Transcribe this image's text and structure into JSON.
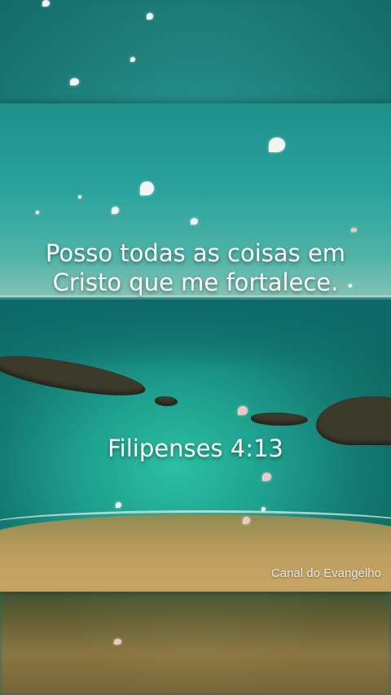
{
  "verse": {
    "text": "Posso todas as coisas em Cristo que me fortalece.",
    "reference": "Filipenses 4:13"
  },
  "channel": {
    "watermark": "Canal do Evangelho"
  },
  "scene": {
    "subject": "seaside-cove",
    "colors": {
      "sea": "#1fa190",
      "sky": "#2aa39d",
      "sand": "#c6a464",
      "text": "#ffffff"
    }
  }
}
